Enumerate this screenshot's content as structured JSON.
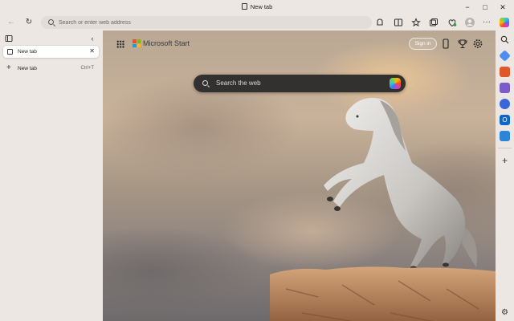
{
  "window": {
    "title": "New tab",
    "minimize_glyph": "−",
    "maximize_glyph": "□",
    "close_glyph": "✕"
  },
  "toolbar": {
    "back_glyph": "←",
    "refresh_glyph": "↻",
    "address_placeholder": "Search or enter web address",
    "more_glyph": "···"
  },
  "tabs_pane": {
    "active_tab_label": "New tab",
    "close_glyph": "✕",
    "collapse_glyph": "‹",
    "new_tab_label": "New tab",
    "new_tab_shortcut": "Ctrl+T"
  },
  "newtab_page": {
    "brand": "Microsoft Start",
    "sign_in_label": "Sign in",
    "search_placeholder": "Search the web"
  },
  "sidebar": {
    "add_glyph": "+",
    "settings_glyph": "⚙"
  },
  "colors": {
    "chrome_bg": "#ece7e2",
    "search_box_bg": "#333030",
    "accent": "#0078d4"
  }
}
